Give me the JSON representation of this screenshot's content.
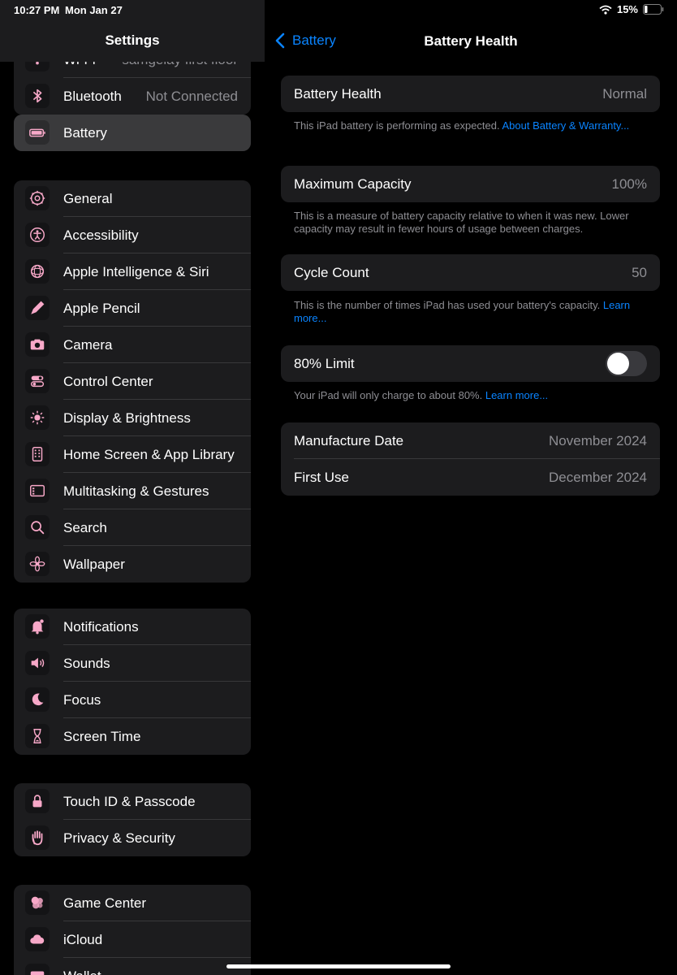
{
  "status": {
    "time": "10:27 PM",
    "date": "Mon Jan 27",
    "battery_pct": "15%"
  },
  "sidebar": {
    "title": "Settings",
    "top_group": [
      {
        "label": "Wi-Fi",
        "value": "samgelay first floor",
        "icon": "wifi-icon"
      },
      {
        "label": "Bluetooth",
        "value": "Not Connected",
        "icon": "bluetooth-icon"
      },
      {
        "label": "Battery",
        "value": "",
        "icon": "battery-icon",
        "selected": true
      }
    ],
    "group2": [
      {
        "label": "General",
        "icon": "gear-icon"
      },
      {
        "label": "Accessibility",
        "icon": "accessibility-icon"
      },
      {
        "label": "Apple Intelligence & Siri",
        "icon": "siri-icon"
      },
      {
        "label": "Apple Pencil",
        "icon": "pencil-icon"
      },
      {
        "label": "Camera",
        "icon": "camera-icon"
      },
      {
        "label": "Control Center",
        "icon": "control-center-icon"
      },
      {
        "label": "Display & Brightness",
        "icon": "sun-icon"
      },
      {
        "label": "Home Screen & App Library",
        "icon": "home-screen-icon"
      },
      {
        "label": "Multitasking & Gestures",
        "icon": "multitasking-icon"
      },
      {
        "label": "Search",
        "icon": "search-icon"
      },
      {
        "label": "Wallpaper",
        "icon": "flower-icon"
      }
    ],
    "group3": [
      {
        "label": "Notifications",
        "icon": "bell-icon"
      },
      {
        "label": "Sounds",
        "icon": "speaker-icon"
      },
      {
        "label": "Focus",
        "icon": "moon-icon"
      },
      {
        "label": "Screen Time",
        "icon": "hourglass-icon"
      }
    ],
    "group4": [
      {
        "label": "Touch ID & Passcode",
        "icon": "lock-icon"
      },
      {
        "label": "Privacy & Security",
        "icon": "hand-icon"
      }
    ],
    "group5": [
      {
        "label": "Game Center",
        "icon": "game-center-icon"
      },
      {
        "label": "iCloud",
        "icon": "cloud-icon"
      },
      {
        "label": "Wallet",
        "icon": "wallet-icon"
      }
    ]
  },
  "detail": {
    "back_label": "Battery",
    "title": "Battery Health",
    "health": {
      "label": "Battery Health",
      "value": "Normal",
      "footer": "This iPad battery is performing as expected. ",
      "footer_link": "About Battery & Warranty..."
    },
    "capacity": {
      "label": "Maximum Capacity",
      "value": "100%",
      "footer": "This is a measure of battery capacity relative to when it was new. Lower capacity may result in fewer hours of usage between charges."
    },
    "cycles": {
      "label": "Cycle Count",
      "value": "50",
      "footer": "This is the number of times iPad has used your battery's capacity. ",
      "footer_link": "Learn more..."
    },
    "limit": {
      "label": "80% Limit",
      "enabled": false,
      "footer": "Your iPad will only charge to about 80%. ",
      "footer_link": "Learn more..."
    },
    "dates": [
      {
        "label": "Manufacture Date",
        "value": "November 2024"
      },
      {
        "label": "First Use",
        "value": "December 2024"
      }
    ]
  },
  "colors": {
    "accent": "#0a84ff",
    "icon_tint": "#f7a8c8",
    "card_bg": "#1c1c1e"
  }
}
